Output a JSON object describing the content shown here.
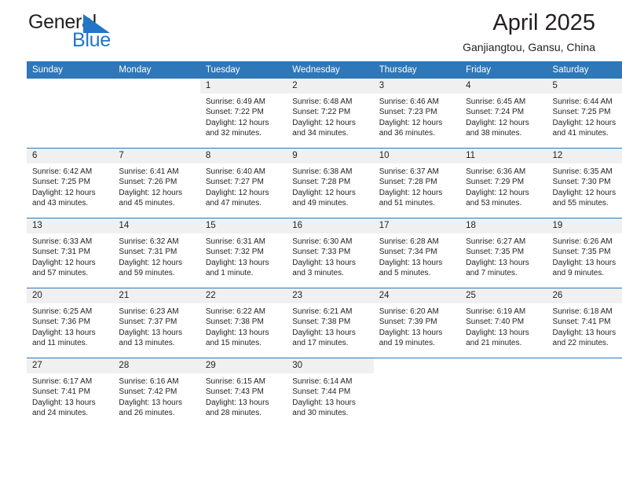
{
  "brand": {
    "name_part1": "General",
    "name_part2": "Blue",
    "accent_color": "#2176c7",
    "triangle_icon": "triangle-icon"
  },
  "header": {
    "title": "April 2025",
    "subtitle": "Ganjiangtou, Gansu, China"
  },
  "theme": {
    "header_blue": "#2e77b8",
    "day_band_gray": "#f0f0f0",
    "text_color": "#231f20"
  },
  "calendar": {
    "weekday_headers": [
      "Sunday",
      "Monday",
      "Tuesday",
      "Wednesday",
      "Thursday",
      "Friday",
      "Saturday"
    ],
    "weeks": [
      [
        {
          "day": "",
          "blank": true,
          "lines": []
        },
        {
          "day": "",
          "blank": true,
          "lines": []
        },
        {
          "day": "1",
          "lines": [
            "Sunrise: 6:49 AM",
            "Sunset: 7:22 PM",
            "Daylight: 12 hours",
            "and 32 minutes."
          ]
        },
        {
          "day": "2",
          "lines": [
            "Sunrise: 6:48 AM",
            "Sunset: 7:22 PM",
            "Daylight: 12 hours",
            "and 34 minutes."
          ]
        },
        {
          "day": "3",
          "lines": [
            "Sunrise: 6:46 AM",
            "Sunset: 7:23 PM",
            "Daylight: 12 hours",
            "and 36 minutes."
          ]
        },
        {
          "day": "4",
          "lines": [
            "Sunrise: 6:45 AM",
            "Sunset: 7:24 PM",
            "Daylight: 12 hours",
            "and 38 minutes."
          ]
        },
        {
          "day": "5",
          "lines": [
            "Sunrise: 6:44 AM",
            "Sunset: 7:25 PM",
            "Daylight: 12 hours",
            "and 41 minutes."
          ]
        }
      ],
      [
        {
          "day": "6",
          "lines": [
            "Sunrise: 6:42 AM",
            "Sunset: 7:25 PM",
            "Daylight: 12 hours",
            "and 43 minutes."
          ]
        },
        {
          "day": "7",
          "lines": [
            "Sunrise: 6:41 AM",
            "Sunset: 7:26 PM",
            "Daylight: 12 hours",
            "and 45 minutes."
          ]
        },
        {
          "day": "8",
          "lines": [
            "Sunrise: 6:40 AM",
            "Sunset: 7:27 PM",
            "Daylight: 12 hours",
            "and 47 minutes."
          ]
        },
        {
          "day": "9",
          "lines": [
            "Sunrise: 6:38 AM",
            "Sunset: 7:28 PM",
            "Daylight: 12 hours",
            "and 49 minutes."
          ]
        },
        {
          "day": "10",
          "lines": [
            "Sunrise: 6:37 AM",
            "Sunset: 7:28 PM",
            "Daylight: 12 hours",
            "and 51 minutes."
          ]
        },
        {
          "day": "11",
          "lines": [
            "Sunrise: 6:36 AM",
            "Sunset: 7:29 PM",
            "Daylight: 12 hours",
            "and 53 minutes."
          ]
        },
        {
          "day": "12",
          "lines": [
            "Sunrise: 6:35 AM",
            "Sunset: 7:30 PM",
            "Daylight: 12 hours",
            "and 55 minutes."
          ]
        }
      ],
      [
        {
          "day": "13",
          "lines": [
            "Sunrise: 6:33 AM",
            "Sunset: 7:31 PM",
            "Daylight: 12 hours",
            "and 57 minutes."
          ]
        },
        {
          "day": "14",
          "lines": [
            "Sunrise: 6:32 AM",
            "Sunset: 7:31 PM",
            "Daylight: 12 hours",
            "and 59 minutes."
          ]
        },
        {
          "day": "15",
          "lines": [
            "Sunrise: 6:31 AM",
            "Sunset: 7:32 PM",
            "Daylight: 13 hours",
            "and 1 minute."
          ]
        },
        {
          "day": "16",
          "lines": [
            "Sunrise: 6:30 AM",
            "Sunset: 7:33 PM",
            "Daylight: 13 hours",
            "and 3 minutes."
          ]
        },
        {
          "day": "17",
          "lines": [
            "Sunrise: 6:28 AM",
            "Sunset: 7:34 PM",
            "Daylight: 13 hours",
            "and 5 minutes."
          ]
        },
        {
          "day": "18",
          "lines": [
            "Sunrise: 6:27 AM",
            "Sunset: 7:35 PM",
            "Daylight: 13 hours",
            "and 7 minutes."
          ]
        },
        {
          "day": "19",
          "lines": [
            "Sunrise: 6:26 AM",
            "Sunset: 7:35 PM",
            "Daylight: 13 hours",
            "and 9 minutes."
          ]
        }
      ],
      [
        {
          "day": "20",
          "lines": [
            "Sunrise: 6:25 AM",
            "Sunset: 7:36 PM",
            "Daylight: 13 hours",
            "and 11 minutes."
          ]
        },
        {
          "day": "21",
          "lines": [
            "Sunrise: 6:23 AM",
            "Sunset: 7:37 PM",
            "Daylight: 13 hours",
            "and 13 minutes."
          ]
        },
        {
          "day": "22",
          "lines": [
            "Sunrise: 6:22 AM",
            "Sunset: 7:38 PM",
            "Daylight: 13 hours",
            "and 15 minutes."
          ]
        },
        {
          "day": "23",
          "lines": [
            "Sunrise: 6:21 AM",
            "Sunset: 7:38 PM",
            "Daylight: 13 hours",
            "and 17 minutes."
          ]
        },
        {
          "day": "24",
          "lines": [
            "Sunrise: 6:20 AM",
            "Sunset: 7:39 PM",
            "Daylight: 13 hours",
            "and 19 minutes."
          ]
        },
        {
          "day": "25",
          "lines": [
            "Sunrise: 6:19 AM",
            "Sunset: 7:40 PM",
            "Daylight: 13 hours",
            "and 21 minutes."
          ]
        },
        {
          "day": "26",
          "lines": [
            "Sunrise: 6:18 AM",
            "Sunset: 7:41 PM",
            "Daylight: 13 hours",
            "and 22 minutes."
          ]
        }
      ],
      [
        {
          "day": "27",
          "lines": [
            "Sunrise: 6:17 AM",
            "Sunset: 7:41 PM",
            "Daylight: 13 hours",
            "and 24 minutes."
          ]
        },
        {
          "day": "28",
          "lines": [
            "Sunrise: 6:16 AM",
            "Sunset: 7:42 PM",
            "Daylight: 13 hours",
            "and 26 minutes."
          ]
        },
        {
          "day": "29",
          "lines": [
            "Sunrise: 6:15 AM",
            "Sunset: 7:43 PM",
            "Daylight: 13 hours",
            "and 28 minutes."
          ]
        },
        {
          "day": "30",
          "lines": [
            "Sunrise: 6:14 AM",
            "Sunset: 7:44 PM",
            "Daylight: 13 hours",
            "and 30 minutes."
          ]
        },
        {
          "day": "",
          "blank": true,
          "lines": []
        },
        {
          "day": "",
          "blank": true,
          "lines": []
        },
        {
          "day": "",
          "blank": true,
          "lines": []
        }
      ]
    ]
  }
}
